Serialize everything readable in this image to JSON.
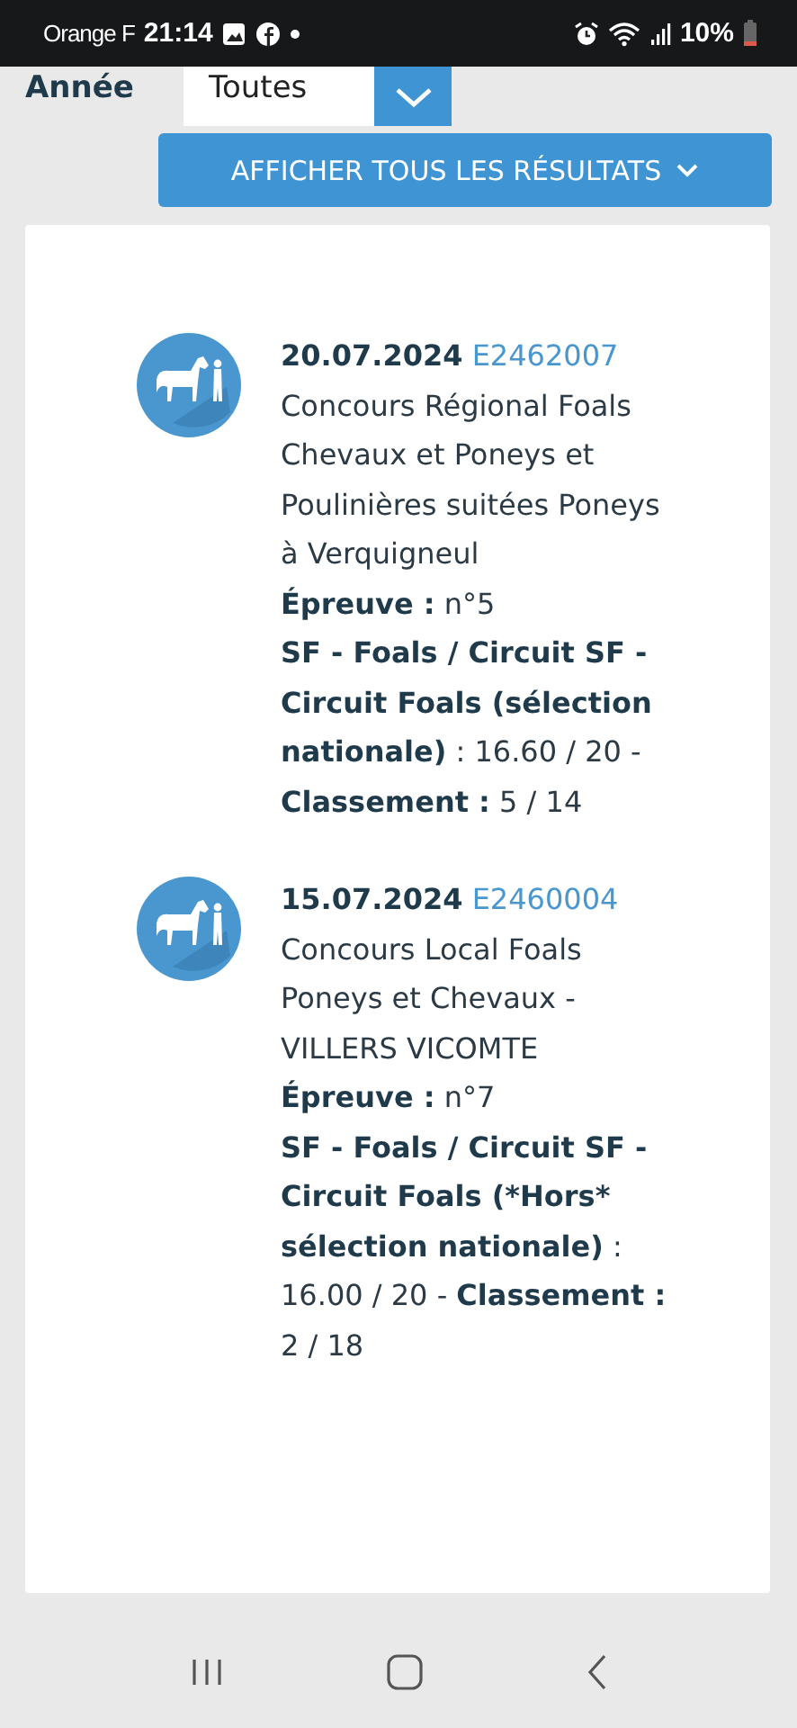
{
  "status_bar": {
    "carrier": "Orange F",
    "time": "21:14",
    "battery": "10%"
  },
  "filter": {
    "label": "Année",
    "value": "Toutes"
  },
  "show_all_button": {
    "label": "AFFICHER TOUS LES RÉSULTATS"
  },
  "results": [
    {
      "date": "20.07.2024",
      "code": "E2462007",
      "title": "Concours Régional Foals Chevaux et Poneys et Poulinières suitées Poneys à Verquigneul",
      "epreuve_label": "Épreuve :",
      "epreuve": "n°5",
      "event": "SF - Foals / Circuit SF - Circuit Foals (sélection nationale)",
      "score": ": 16.60 / 20 -",
      "rank_label": "Classement :",
      "rank": "5 / 14"
    },
    {
      "date": "15.07.2024",
      "code": "E2460004",
      "title": "Concours Local Foals Poneys et Chevaux - VILLERS VICOMTE",
      "epreuve_label": "Épreuve :",
      "epreuve": "n°7",
      "event": "SF - Foals / Circuit SF - Circuit Foals (*Hors* sélection nationale)",
      "score": ": 16.00 / 20 -",
      "rank_label": "Classement :",
      "rank": "2 / 18"
    }
  ]
}
